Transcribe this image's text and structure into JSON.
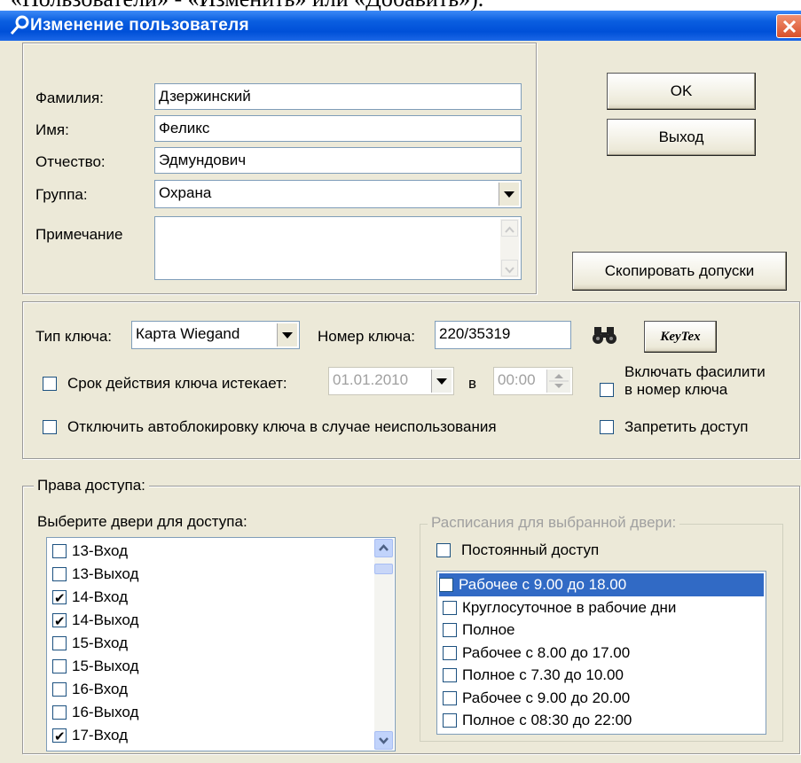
{
  "top_caption": "«Пользователи» - «Изменить» или «Добавить»).",
  "window": {
    "title": "Изменение пользователя"
  },
  "user": {
    "surname_label": "Фамилия:",
    "surname": "Дзержинский",
    "name_label": "Имя:",
    "name": "Феликс",
    "patronymic_label": "Отчество:",
    "patronymic": "Эдмундович",
    "group_label": "Группа:",
    "group": "Охрана",
    "note_label": "Примечание",
    "note": ""
  },
  "buttons": {
    "ok": "OK",
    "exit": "Выход",
    "copy_access": "Скопировать допуски",
    "keytex": "KeyTex"
  },
  "key": {
    "type_label": "Тип ключа:",
    "type": "Карта Wiegand",
    "number_label": "Номер ключа:",
    "number": "220/35319",
    "expire_label": "Срок действия ключа истекает:",
    "expire_date": "01.01.2010",
    "at_label": "в",
    "expire_time": "00:00",
    "facility_label_1": "Включать фасилити",
    "facility_label_2": "в номер ключа",
    "autoblock_label": "Отключить автоблокировку ключа в случае неиспользования",
    "deny_label": "Запретить доступ"
  },
  "access": {
    "group_label": "Права доступа:",
    "doors_label": "Выберите двери для доступа:",
    "doors": [
      {
        "label": "13-Вход",
        "checked": false
      },
      {
        "label": "13-Выход",
        "checked": false
      },
      {
        "label": "14-Вход",
        "checked": true
      },
      {
        "label": "14-Выход",
        "checked": true
      },
      {
        "label": "15-Вход",
        "checked": false
      },
      {
        "label": "15-Выход",
        "checked": false
      },
      {
        "label": "16-Вход",
        "checked": false
      },
      {
        "label": "16-Выход",
        "checked": false
      },
      {
        "label": "17-Вход",
        "checked": true
      }
    ],
    "schedule_group_label": "Расписания для выбранной двери:",
    "permanent_label": "Постоянный доступ",
    "schedules": [
      {
        "label": "Рабочее с 9.00 до 18.00",
        "selected": true
      },
      {
        "label": "Круглосуточное в рабочие дни",
        "selected": false
      },
      {
        "label": "Полное",
        "selected": false
      },
      {
        "label": "Рабочее с 8.00 до 17.00",
        "selected": false
      },
      {
        "label": "Полное с 7.30 до 10.00",
        "selected": false
      },
      {
        "label": "Рабочее с 9.00 до 20.00",
        "selected": false
      },
      {
        "label": "Полное с 08:30 до 22:00",
        "selected": false
      }
    ]
  },
  "colors": {
    "titlebar": "#0a5ee0",
    "dialog_bg": "#ece9d8",
    "selection": "#316ac5"
  }
}
